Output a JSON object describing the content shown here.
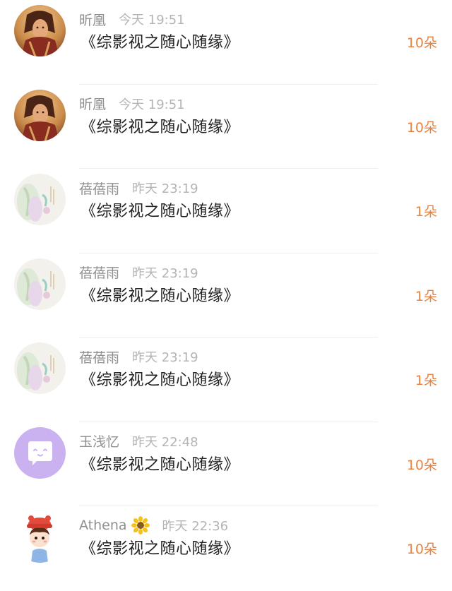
{
  "colors": {
    "accent": "#e8823e",
    "name": "#8f8f8f",
    "time": "#b4b4b4",
    "title": "#222222"
  },
  "rows": [
    {
      "name": "昕凰",
      "time": "今天 19:51",
      "work": "《综影视之随心随缘》",
      "gift": "10朵",
      "avatar": "warrior-avatar"
    },
    {
      "name": "昕凰",
      "time": "今天 19:51",
      "work": "《综影视之随心随缘》",
      "gift": "10朵",
      "avatar": "warrior-avatar"
    },
    {
      "name": "蓓蓓雨",
      "time": "昨天 23:19",
      "work": "《综影视之随心随缘》",
      "gift": "1朵",
      "avatar": "painting-avatar"
    },
    {
      "name": "蓓蓓雨",
      "time": "昨天 23:19",
      "work": "《综影视之随心随缘》",
      "gift": "1朵",
      "avatar": "painting-avatar"
    },
    {
      "name": "蓓蓓雨",
      "time": "昨天 23:19",
      "work": "《综影视之随心随缘》",
      "gift": "1朵",
      "avatar": "painting-avatar"
    },
    {
      "name": "玉浅忆",
      "time": "昨天 22:48",
      "work": "《综影视之随心随缘》",
      "gift": "10朵",
      "avatar": "chat-bubble-avatar"
    },
    {
      "name": "Athena",
      "time": "昨天 22:36",
      "work": "《综影视之随心随缘》",
      "gift": "10朵",
      "avatar": "cartoon-girl-avatar",
      "badge": "sunflower-icon"
    }
  ]
}
